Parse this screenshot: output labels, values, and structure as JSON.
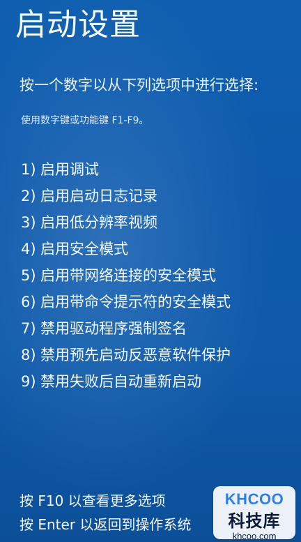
{
  "screen": {
    "title": "启动设置",
    "prompt": "按一个数字以从下列选项中进行选择:",
    "hint": "使用数字键或功能键 F1-F9。"
  },
  "options": [
    {
      "num": "1)",
      "label": "启用调试"
    },
    {
      "num": "2)",
      "label": "启用启动日志记录"
    },
    {
      "num": "3)",
      "label": "启用低分辨率视频"
    },
    {
      "num": "4)",
      "label": "启用安全模式"
    },
    {
      "num": "5)",
      "label": "启用带网络连接的安全模式"
    },
    {
      "num": "6)",
      "label": "启用带命令提示符的安全模式"
    },
    {
      "num": "7)",
      "label": "禁用驱动程序强制签名"
    },
    {
      "num": "8)",
      "label": "禁用预先启动反恶意软件保护"
    },
    {
      "num": "9)",
      "label": "禁用失败后自动重新启动"
    }
  ],
  "footer": {
    "line1": "按 F10 以查看更多选项",
    "line2": "按 Enter 以返回到操作系统"
  },
  "watermark": {
    "top": "KHCOO",
    "middle": "科技库",
    "bottom": "khcoo.com"
  }
}
